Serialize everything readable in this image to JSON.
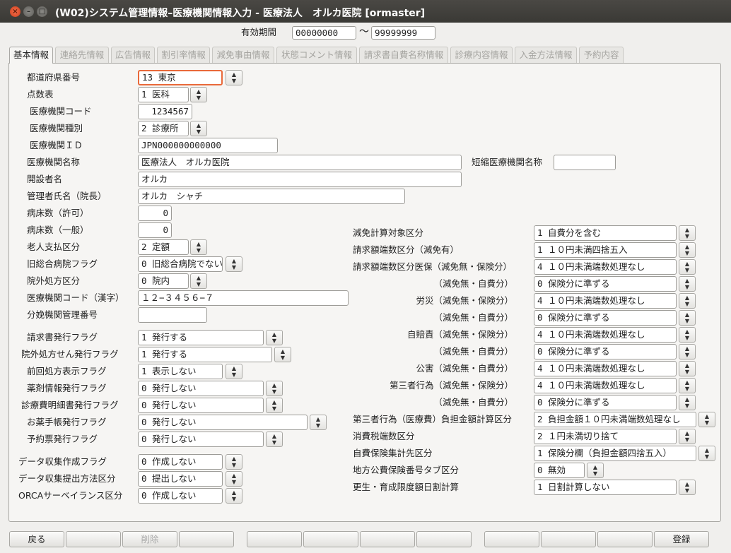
{
  "window": {
    "title": "(W02)システム管理情報–医療機関情報入力 - 医療法人　オルカ医院 [ormaster]",
    "close": "×",
    "minimize": "–",
    "maximize": "□"
  },
  "period": {
    "label": "有効期間",
    "from": "00000000",
    "tilde": "〜",
    "to": "99999999"
  },
  "tabs": [
    {
      "label": "基本情報"
    },
    {
      "label": "連絡先情報"
    },
    {
      "label": "広告情報"
    },
    {
      "label": "割引率情報"
    },
    {
      "label": "減免事由情報"
    },
    {
      "label": "状態コメント情報"
    },
    {
      "label": "請求書自費名称情報"
    },
    {
      "label": "診療内容情報"
    },
    {
      "label": "入金方法情報"
    },
    {
      "label": "予約内容"
    }
  ],
  "spin_glyph": "▲\n▼",
  "left": {
    "prefecture": {
      "label": "都道府県番号",
      "value": "13 東京"
    },
    "tensuhyo": {
      "label": "点数表",
      "value": "1 医科"
    },
    "inst_code": {
      "label": "医療機関コード",
      "value": "1234567"
    },
    "inst_type": {
      "label": "医療機関種別",
      "value": "2 診療所"
    },
    "inst_id": {
      "label": "医療機関ＩＤ",
      "value": "JPN000000000000"
    },
    "inst_name": {
      "label": "医療機関名称",
      "value": "医療法人　オルカ医院"
    },
    "short_name": {
      "label": "短縮医療機関名称",
      "value": ""
    },
    "founder": {
      "label": "開設者名",
      "value": "オルカ"
    },
    "manager": {
      "label": "管理者氏名（院長）",
      "value": "オルカ　シャチ"
    },
    "beds_permit": {
      "label": "病床数（許可）",
      "value": "0"
    },
    "beds_general": {
      "label": "病床数（一般）",
      "value": "0"
    },
    "elderly": {
      "label": "老人支払区分",
      "value": "2 定額"
    },
    "old_general": {
      "label": "旧総合病院フラグ",
      "value": "0 旧総合病院でない"
    },
    "outside_rx": {
      "label": "院外処方区分",
      "value": "0 院内"
    },
    "inst_code_kanji": {
      "label": "医療機関コード（漢字）",
      "value": "１２−３４５６−７"
    },
    "birth_no": {
      "label": "分娩機関管理番号",
      "value": ""
    },
    "bill_flag": {
      "label": "請求書発行フラグ",
      "value": "1 発行する"
    },
    "outside_rx_flag": {
      "label": "院外処方せん発行フラグ",
      "value": "1 発行する"
    },
    "prev_rx_flag": {
      "label": "前回処方表示フラグ",
      "value": "1 表示しない"
    },
    "drug_info_flag": {
      "label": "薬剤情報発行フラグ",
      "value": "0 発行しない"
    },
    "statement_flag": {
      "label": "診療費明細書発行フラグ",
      "value": "0 発行しない"
    },
    "notebook_flag": {
      "label": "お薬手帳発行フラグ",
      "value": "0 発行しない"
    },
    "appt_flag": {
      "label": "予約票発行フラグ",
      "value": "0 発行しない"
    },
    "data_create": {
      "label": "データ収集作成フラグ",
      "value": "0 作成しない"
    },
    "data_submit": {
      "label": "データ収集提出方法区分",
      "value": "0 提出しない"
    },
    "orca_surv": {
      "label": "ORCAサーベイランス区分",
      "value": "0 作成しない"
    }
  },
  "right": {
    "genmen_target": {
      "label": "減免計算対象区分",
      "value": "1 自費分を含む"
    },
    "round_genmen": {
      "label": "請求額端数区分（減免有）",
      "value": "1 １０円未満四捨五入"
    },
    "round_iho_ins": {
      "label": "請求額端数区分医保（減免無・保険分）",
      "value": "4 １０円未満端数処理なし"
    },
    "round_iho_self": {
      "label": "（減免無・自費分）",
      "value": "0 保険分に準ずる"
    },
    "rousai_ins": {
      "label": "労災（減免無・保険分）",
      "value": "4 １０円未満端数処理なし"
    },
    "rousai_self": {
      "label": "（減免無・自費分）",
      "value": "0 保険分に準ずる"
    },
    "jibai_ins": {
      "label": "自賠責（減免無・保険分）",
      "value": "4 １０円未満端数処理なし"
    },
    "jibai_self": {
      "label": "（減免無・自費分）",
      "value": "0 保険分に準ずる"
    },
    "kougai_self": {
      "label": "公害（減免無・自費分）",
      "value": "4 １０円未満端数処理なし"
    },
    "third_ins": {
      "label": "第三者行為（減免無・保険分）",
      "value": "4 １０円未満端数処理なし"
    },
    "third_self": {
      "label": "（減免無・自費分）",
      "value": "0 保険分に準ずる"
    },
    "third_med": {
      "label": "第三者行為（医療費）負担金額計算区分",
      "value": "2 負担金額１０円未満端数処理なし"
    },
    "tax_round": {
      "label": "消費税端数区分",
      "value": "2 １円未満切り捨て"
    },
    "self_ins_dest": {
      "label": "自費保険集計先区分",
      "value": "1 保険分欄（負担金額四捨五入）"
    },
    "local_tab": {
      "label": "地方公費保険番号タブ区分",
      "value": "0 無効"
    },
    "rehab_daily": {
      "label": "更生・育成限度額日割計算",
      "value": "1 日割計算しない"
    }
  },
  "footer": {
    "back": "戻る",
    "delete": "削除",
    "register": "登録"
  }
}
